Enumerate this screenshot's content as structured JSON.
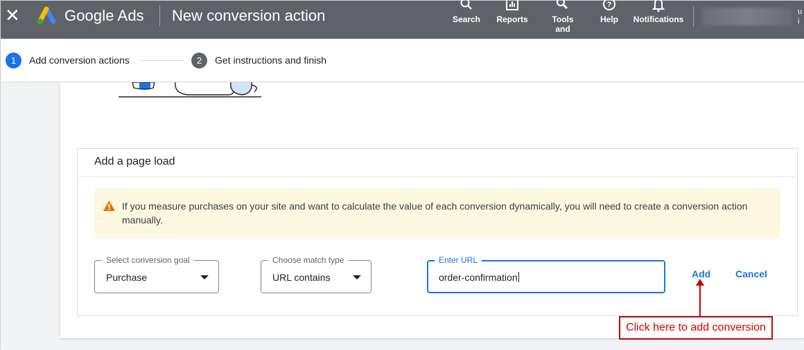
{
  "topbar": {
    "close_icon": "close-icon",
    "brand": "Google Ads",
    "title": "New conversion action",
    "tools": [
      {
        "label": "Search",
        "icon": "search-icon"
      },
      {
        "label": "Reports",
        "icon": "reports-icon"
      },
      {
        "label": "Tools and",
        "icon": "wrench-icon"
      },
      {
        "label": "Help",
        "icon": "help-icon"
      },
      {
        "label": "Notifications",
        "icon": "bell-icon"
      }
    ],
    "edge_text": "u\ni"
  },
  "stepper": {
    "steps": [
      {
        "number": "1",
        "label": "Add conversion actions",
        "state": "active"
      },
      {
        "number": "2",
        "label": "Get instructions and finish",
        "state": "pending"
      }
    ]
  },
  "panel": {
    "title": "Add a page load",
    "warning": "If you measure purchases on your site and want to calculate the value of each conversion dynamically, you will need to create a conversion action manually.",
    "goal": {
      "label": "Select conversion goal",
      "value": "Purchase"
    },
    "match": {
      "label": "Choose match type",
      "value": "URL contains"
    },
    "url": {
      "label": "Enter URL",
      "value": "order-confirmation"
    },
    "add_label": "Add",
    "cancel_label": "Cancel"
  },
  "annotation": {
    "text": "Click here to add conversion"
  },
  "colors": {
    "topbar": "#5f6368",
    "accent": "#1a73e8",
    "warning_bg": "#fef7e0",
    "annotation": "#d00000"
  }
}
